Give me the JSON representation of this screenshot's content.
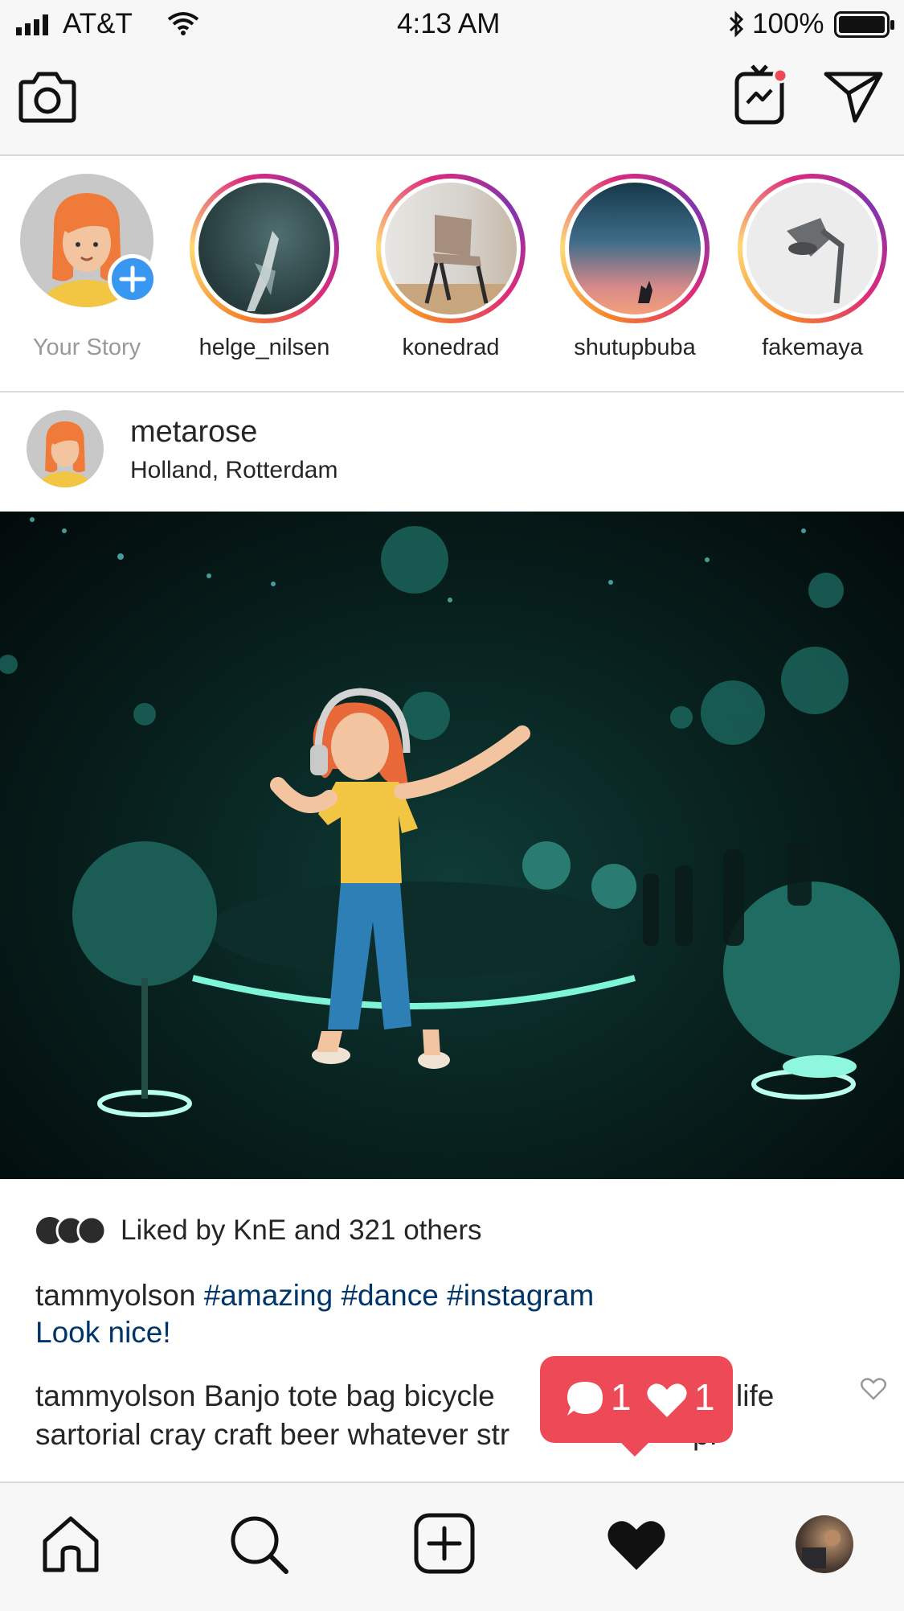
{
  "status_bar": {
    "carrier": "AT&T",
    "time": "4:13 AM",
    "battery": "100%"
  },
  "stories": [
    {
      "label": "Your Story",
      "own": true
    },
    {
      "label": "helge_nilsen"
    },
    {
      "label": "konedrad"
    },
    {
      "label": "shutupbuba"
    },
    {
      "label": "fakemaya"
    }
  ],
  "post": {
    "username": "metarose",
    "location": "Holland, Rotterdam",
    "likes_text": "Liked by KnE and 321 others",
    "caption_user": "tammyolson",
    "caption_tags": "#amazing #dance #instagram",
    "caption_link": "Look nice!",
    "comment_user": "tammyolson",
    "comment_line1_a": "Banjo tote bag bicycle",
    "comment_line1_b": "life",
    "comment_line2_a": "sartorial cray craft beer whatever str",
    "comment_line2_b": "p."
  },
  "notification": {
    "comments": "1",
    "likes": "1",
    "color": "#ed4956"
  },
  "colors": {
    "bar_bg": "#f7f7f7",
    "hashtag": "#003569",
    "add_badge": "#3897f0"
  },
  "icons": [
    "camera-icon",
    "igtv-icon",
    "direct-icon",
    "home-icon",
    "search-icon",
    "add-post-icon",
    "heart-icon",
    "profile-avatar"
  ]
}
